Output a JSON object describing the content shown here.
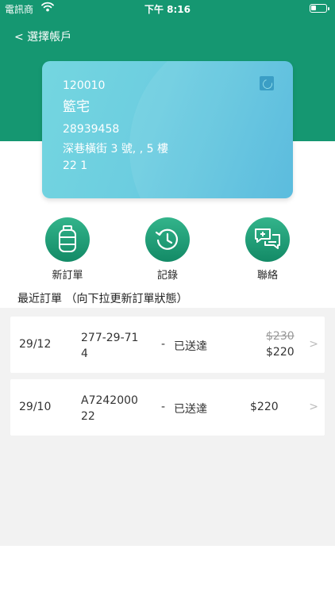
{
  "status_bar": {
    "carrier": "電訊商",
    "time": "下午 8:16"
  },
  "header": {
    "back_label": "< 選擇帳戶",
    "background_color": "#159771"
  },
  "account_card": {
    "code": "120010",
    "name": "籃宅",
    "phone": "28939458",
    "address": "深巷橫街 3 號, , 5 樓",
    "extra": "22    1"
  },
  "actions": [
    {
      "label": "新訂單",
      "icon": "gas-cylinder-icon"
    },
    {
      "label": "記錄",
      "icon": "history-icon"
    },
    {
      "label": "聯絡",
      "icon": "chat-bubbles-icon"
    }
  ],
  "orders_section": {
    "title": "最近訂單 （向下拉更新訂單狀態）"
  },
  "orders": [
    {
      "date": "29/12",
      "order_no": "277-29-714",
      "dash": "-",
      "status": "已送達",
      "original_price": "$230",
      "price": "$220"
    },
    {
      "date": "29/10",
      "order_no": "A724200022",
      "dash": "-",
      "status": "已送達",
      "original_price": "",
      "price": "$220"
    }
  ]
}
